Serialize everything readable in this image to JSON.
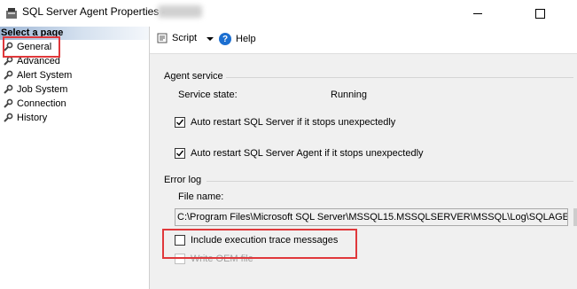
{
  "window": {
    "title": "SQL Server Agent Properties -"
  },
  "left_pane": {
    "header": "Select a page",
    "pages": [
      {
        "label": "General"
      },
      {
        "label": "Advanced"
      },
      {
        "label": "Alert System"
      },
      {
        "label": "Job System"
      },
      {
        "label": "Connection"
      },
      {
        "label": "History"
      }
    ]
  },
  "toolbar": {
    "script_label": "Script",
    "help_label": "Help"
  },
  "agent_service": {
    "group_label": "Agent service",
    "state_label": "Service state:",
    "state_value": "Running",
    "auto_restart_server_label": "Auto restart SQL Server if it stops unexpectedly",
    "auto_restart_server_checked": true,
    "auto_restart_agent_label": "Auto restart SQL Server Agent if it stops unexpectedly",
    "auto_restart_agent_checked": true
  },
  "error_log": {
    "group_label": "Error log",
    "file_name_label": "File name:",
    "file_name_value": "C:\\Program Files\\Microsoft SQL Server\\MSSQL15.MSSQLSERVER\\MSSQL\\Log\\SQLAGEN",
    "include_trace_label": "Include execution trace messages",
    "include_trace_checked": false,
    "write_oem_label": "Write OEM file",
    "write_oem_checked": false
  },
  "colors": {
    "highlight_box": "#e0383b",
    "content_bg": "#f0f0f0",
    "help_icon": "#1c6fd1"
  }
}
